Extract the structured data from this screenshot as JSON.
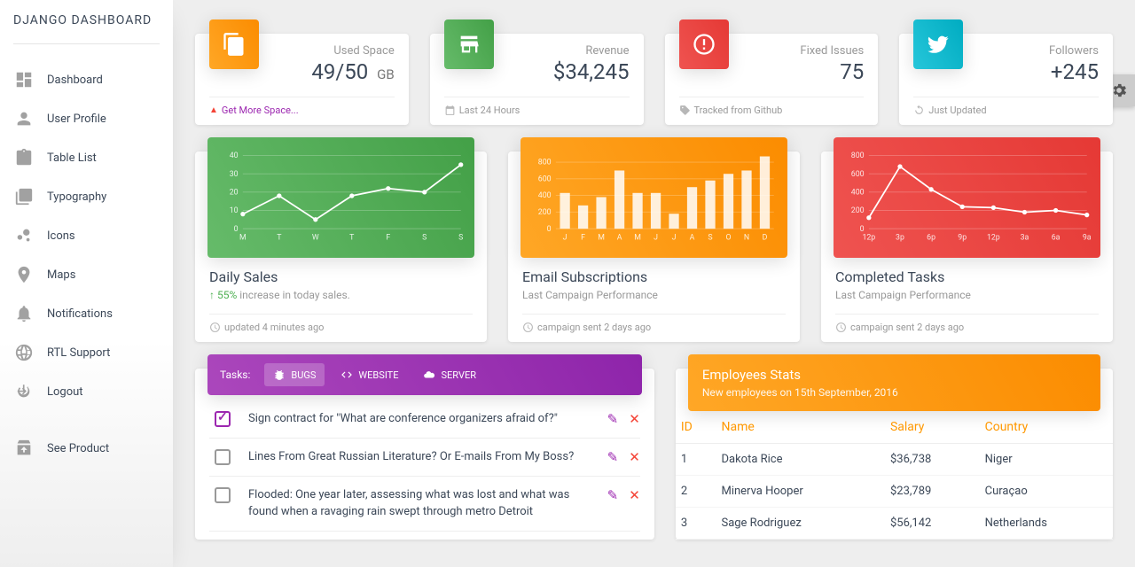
{
  "logo": "DJANGO DASHBOARD",
  "sidebar": {
    "items": [
      {
        "label": "Dashboard"
      },
      {
        "label": "User Profile"
      },
      {
        "label": "Table List"
      },
      {
        "label": "Typography"
      },
      {
        "label": "Icons"
      },
      {
        "label": "Maps"
      },
      {
        "label": "Notifications"
      },
      {
        "label": "RTL Support"
      },
      {
        "label": "Logout"
      }
    ],
    "bottom_label": "See Product"
  },
  "stats": [
    {
      "label": "Used Space",
      "value": "49/50",
      "unit": "GB",
      "footer": "Get More Space...",
      "footer_is_link": true
    },
    {
      "label": "Revenue",
      "value": "$34,245",
      "unit": "",
      "footer": "Last 24 Hours"
    },
    {
      "label": "Fixed Issues",
      "value": "75",
      "unit": "",
      "footer": "Tracked from Github"
    },
    {
      "label": "Followers",
      "value": "+245",
      "unit": "",
      "footer": "Just Updated"
    }
  ],
  "charts": [
    {
      "title": "Daily Sales",
      "sub_prefix": "↑ 55%",
      "sub_rest": " increase in today sales.",
      "footer": "updated 4 minutes ago"
    },
    {
      "title": "Email Subscriptions",
      "sub": "Last Campaign Performance",
      "footer": "campaign sent 2 days ago"
    },
    {
      "title": "Completed Tasks",
      "sub": "Last Campaign Performance",
      "footer": "campaign sent 2 days ago"
    }
  ],
  "chart_data": [
    {
      "type": "line",
      "categories": [
        "M",
        "T",
        "W",
        "T",
        "F",
        "S",
        "S"
      ],
      "values": [
        8,
        18,
        5,
        18,
        22,
        20,
        35
      ],
      "y_ticks": [
        0,
        10,
        20,
        30,
        40
      ],
      "ylim": [
        0,
        40
      ]
    },
    {
      "type": "bar",
      "categories": [
        "J",
        "F",
        "M",
        "A",
        "M",
        "J",
        "J",
        "A",
        "S",
        "O",
        "N",
        "D"
      ],
      "values": [
        430,
        280,
        380,
        700,
        430,
        430,
        180,
        500,
        580,
        660,
        700,
        870
      ],
      "y_ticks": [
        0,
        200,
        400,
        600,
        800
      ],
      "ylim": [
        0,
        880
      ]
    },
    {
      "type": "line",
      "categories": [
        "12p",
        "3p",
        "6p",
        "9p",
        "12p",
        "3a",
        "6a",
        "9a"
      ],
      "values": [
        120,
        680,
        430,
        240,
        230,
        180,
        200,
        150
      ],
      "y_ticks": [
        0,
        200,
        400,
        600,
        800
      ],
      "ylim": [
        0,
        800
      ]
    }
  ],
  "tasks": {
    "header_label": "Tasks:",
    "tabs": [
      {
        "label": "BUGS"
      },
      {
        "label": "WEBSITE"
      },
      {
        "label": "SERVER"
      }
    ],
    "items": [
      {
        "checked": true,
        "text": "Sign contract for \"What are conference organizers afraid of?\""
      },
      {
        "checked": false,
        "text": "Lines From Great Russian Literature? Or E-mails From My Boss?"
      },
      {
        "checked": false,
        "text": "Flooded: One year later, assessing what was lost and what was found when a ravaging rain swept through metro Detroit"
      }
    ]
  },
  "employees": {
    "title": "Employees Stats",
    "subtitle": "New employees on 15th September, 2016",
    "columns": [
      "ID",
      "Name",
      "Salary",
      "Country"
    ],
    "rows": [
      {
        "id": "1",
        "name": "Dakota Rice",
        "salary": "$36,738",
        "country": "Niger"
      },
      {
        "id": "2",
        "name": "Minerva Hooper",
        "salary": "$23,789",
        "country": "Curaçao"
      },
      {
        "id": "3",
        "name": "Sage Rodriguez",
        "salary": "$56,142",
        "country": "Netherlands"
      }
    ]
  }
}
